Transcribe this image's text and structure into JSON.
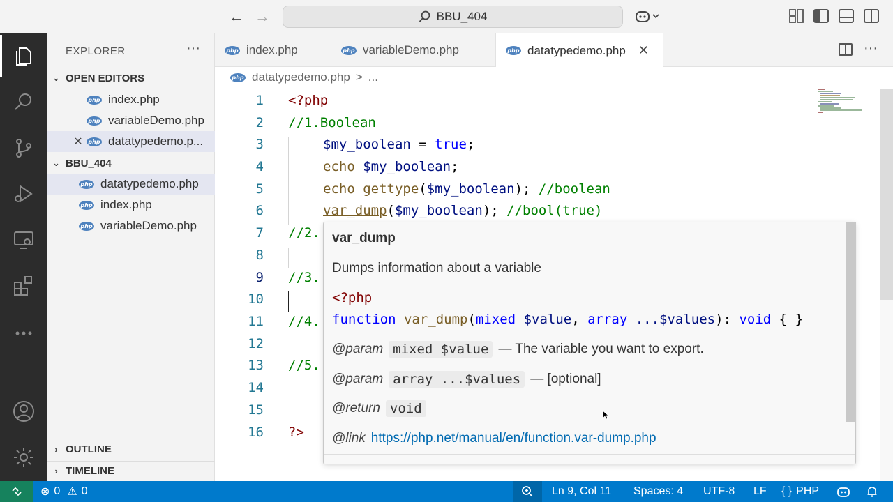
{
  "titlebar": {
    "back": "←",
    "forward": "→",
    "search_text": "BBU_404",
    "copilot": "⌂⌄"
  },
  "sidebar": {
    "title": "EXPLORER",
    "more": "···",
    "open_editors_label": "OPEN EDITORS",
    "open_editors": [
      {
        "name": "index.php"
      },
      {
        "name": "variableDemo.php"
      },
      {
        "name": "datatypedemo.p..."
      }
    ],
    "folder_label": "BBU_404",
    "folder_files": [
      {
        "name": "datatypedemo.php"
      },
      {
        "name": "index.php"
      },
      {
        "name": "variableDemo.php"
      }
    ],
    "outline_label": "OUTLINE",
    "timeline_label": "TIMELINE",
    "php_badge": "php"
  },
  "tabs": [
    {
      "name": "index.php"
    },
    {
      "name": "variableDemo.php"
    },
    {
      "name": "datatypedemo.php"
    }
  ],
  "breadcrumb": {
    "file": "datatypedemo.php",
    "sep": ">",
    "rest": "..."
  },
  "editor": {
    "line_numbers": [
      "1",
      "2",
      "3",
      "4",
      "5",
      "6",
      "7",
      "8",
      "9",
      "10",
      "11",
      "12",
      "13",
      "14",
      "15",
      "16"
    ],
    "lines": {
      "l1": "<?php",
      "l2": "//1.Boolean",
      "l3a": "$my_boolean",
      "l3b": " = ",
      "l3c": "true",
      "l3d": ";",
      "l4a": "echo ",
      "l4b": "$my_boolean",
      "l4c": ";",
      "l5a": "echo ",
      "l5b": "gettype",
      "l5c": "(",
      "l5d": "$my_boolean",
      "l5e": "); ",
      "l5f": "//boolean",
      "l6a": "var_dump",
      "l6b": "(",
      "l6c": "$my_boolean",
      "l6d": "); ",
      "l6e": "//bool(true)",
      "l7": "//2.",
      "l9": "//3.",
      "l11": "//4.",
      "l13": "//5.",
      "l16": "?>"
    }
  },
  "hover": {
    "title": "var_dump",
    "description": "Dumps information about a variable",
    "code_open": "<?php",
    "sig_kw": "function ",
    "sig_fn": "var_dump",
    "sig_p1": "(",
    "sig_type1": "mixed",
    "sig_var1": " $value",
    "sig_comma": ", ",
    "sig_type2": "array",
    "sig_var2": " ...$values",
    "sig_ret": "): ",
    "sig_void": "void",
    "sig_end": " { }",
    "param1_tag": "@param",
    "param1_code": "mixed $value",
    "param1_text": "— The variable you want to export.",
    "param2_tag": "@param",
    "param2_code": "array ...$values",
    "param2_text": "— [optional]",
    "return_tag": "@return",
    "return_code": "void",
    "link_tag": "@link",
    "link_url": "https://php.net/manual/en/function.var-dump.php"
  },
  "statusbar": {
    "errors": "0",
    "warnings": "0",
    "position": "Ln 9, Col 11",
    "spaces": "Spaces: 4",
    "encoding": "UTF-8",
    "eol": "LF",
    "language_braces": "{ }",
    "language": "PHP"
  }
}
